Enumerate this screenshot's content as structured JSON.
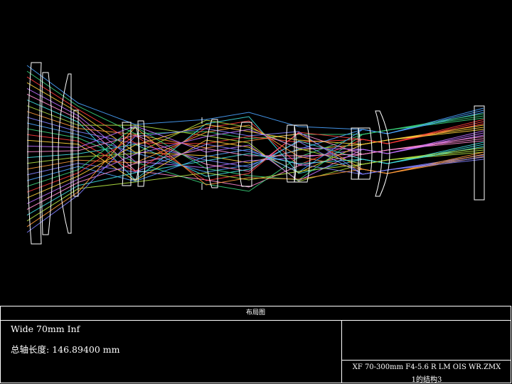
{
  "panel": {
    "header": "布局图",
    "config_line": "Wide 70mm Inf",
    "length_label": "总轴长度:",
    "length_value": "146.89400 mm",
    "file_name": "XF 70-300mm F4-5.6 R LM OIS WR.ZMX",
    "config_info": "1的结构3"
  },
  "colors": {
    "background": "#000000",
    "lens_outline": "#ffffff",
    "rays": [
      "#4aa3ff",
      "#3ad17a",
      "#ff3b3b",
      "#ffd23a",
      "#c070ff",
      "#ff8ad0",
      "#3fe0e0",
      "#b0e040",
      "#ff9a3a",
      "#8080ff"
    ]
  }
}
